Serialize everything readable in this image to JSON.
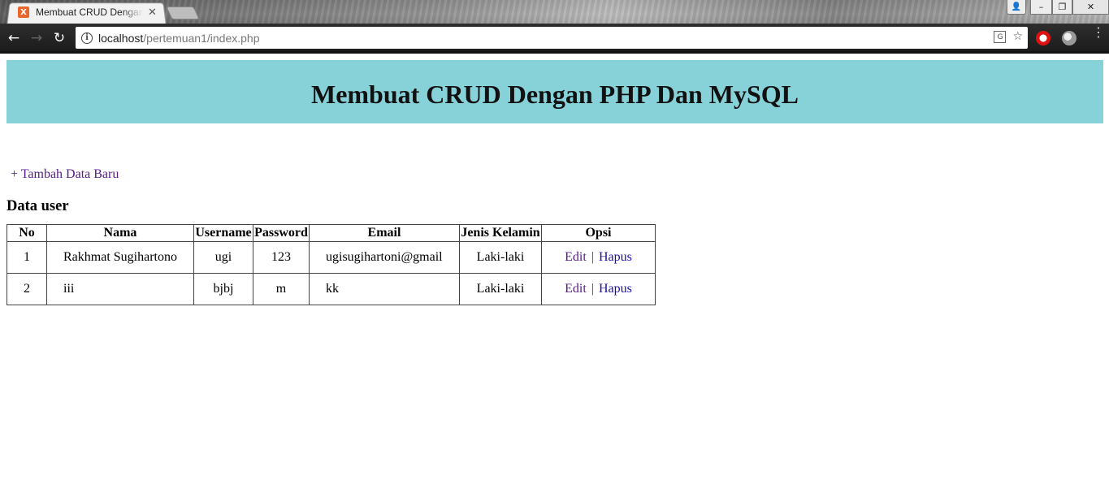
{
  "browser": {
    "tab_title": "Membuat CRUD Dengan PHP Dan MySQL",
    "tab_favicon_text": "X",
    "tab_close": "✕",
    "url_host": "localhost",
    "url_path": "/pertemuan1/index.php",
    "window_controls": {
      "minimize": "–",
      "restore": "❐",
      "close": "✕"
    },
    "icons": {
      "back": "arrow-left-icon",
      "forward": "arrow-right-icon",
      "reload": "reload-icon",
      "info": "info-icon",
      "translate": "translate-icon",
      "bookmark": "star-icon",
      "menu": "kebab-menu-icon"
    },
    "nav_glyphs": {
      "back": "←",
      "forward": "→",
      "reload": "↻",
      "info": "i",
      "translate": "G",
      "bookmark": "☆",
      "profile": "👤",
      "menu": "⋮"
    }
  },
  "page": {
    "header_title": "Membuat CRUD Dengan PHP Dan MySQL",
    "add_link": "+ Tambah Data Baru",
    "section_title": "Data user",
    "table": {
      "headers": [
        "No",
        "Nama",
        "Username",
        "Password",
        "Email",
        "Jenis Kelamin",
        "Opsi"
      ],
      "rows": [
        {
          "no": "1",
          "nama": "Rakhmat Sugihartono",
          "username": "ugi",
          "password": "123",
          "email": "ugisugihartoni@gmail",
          "jenis_kelamin": "Laki-laki",
          "edit": "Edit",
          "hapus": "Hapus"
        },
        {
          "no": "2",
          "nama": "iii",
          "username": "bjbj",
          "password": "m",
          "email": "kk",
          "jenis_kelamin": "Laki-laki",
          "edit": "Edit",
          "hapus": "Hapus"
        }
      ],
      "separator": "|"
    },
    "colors": {
      "banner_bg": "#87d2d9",
      "visited_link": "#551a8b",
      "link": "#1a0dab"
    }
  }
}
